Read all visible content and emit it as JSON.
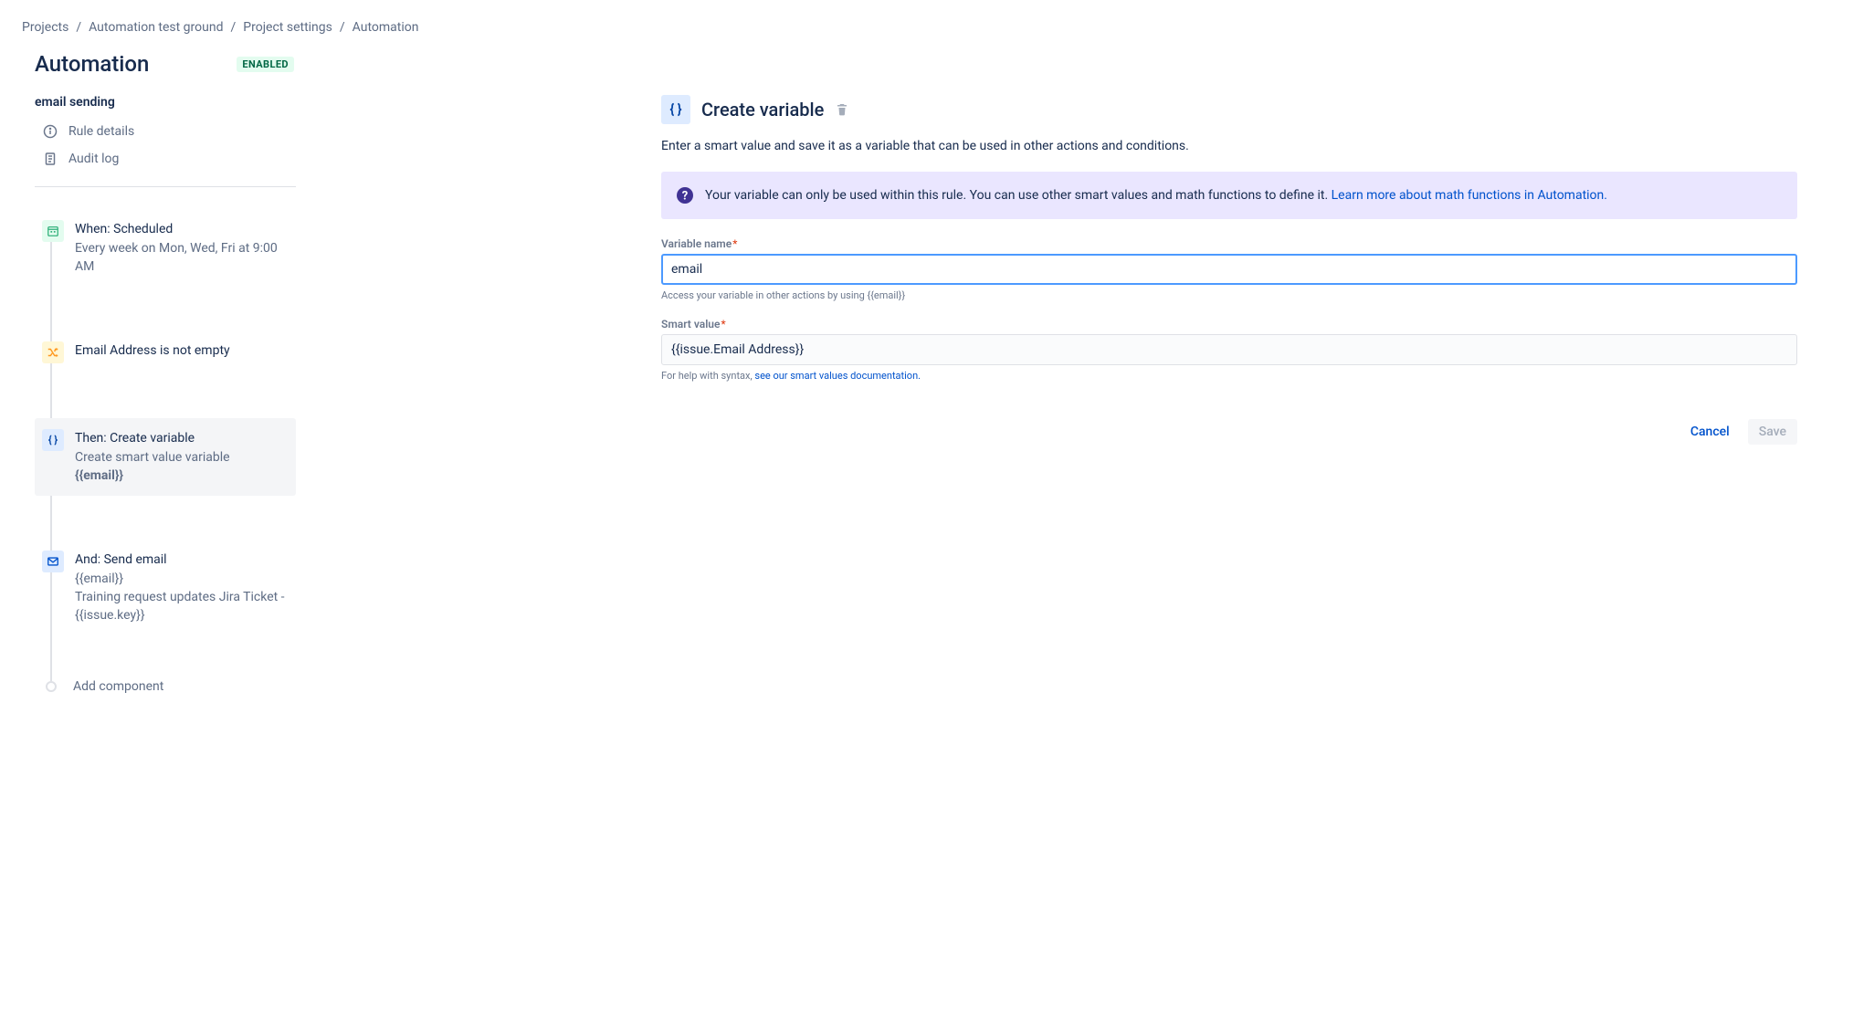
{
  "breadcrumb": {
    "projects": "Projects",
    "project": "Automation test ground",
    "settings": "Project settings",
    "current": "Automation"
  },
  "header": {
    "title": "Automation",
    "status": "ENABLED"
  },
  "rule": {
    "name": "email sending",
    "meta": {
      "details": "Rule details",
      "audit": "Audit log"
    },
    "flow": {
      "trigger": {
        "title": "When: Scheduled",
        "sub": "Every week on Mon, Wed, Fri at 9:00 AM"
      },
      "condition": {
        "title": "Email Address is not empty"
      },
      "action1": {
        "title": "Then: Create variable",
        "sub": "Create smart value variable",
        "var": "{{email}}"
      },
      "action2": {
        "title": "And: Send email",
        "line1": "{{email}}",
        "line2": "Training request updates Jira Ticket - {{issue.key}}"
      },
      "add": "Add component"
    }
  },
  "panel": {
    "title": "Create variable",
    "description": "Enter a smart value and save it as a variable that can be used in other actions and conditions.",
    "info": {
      "text": "Your variable can only be used within this rule. You can use other smart values and math functions to define it. ",
      "link": "Learn more about math functions in Automation."
    },
    "variable_name": {
      "label": "Variable name",
      "value": "email",
      "help": "Access your variable in other actions by using {{email}}"
    },
    "smart_value": {
      "label": "Smart value",
      "value": "{{issue.Email Address}}",
      "help_prefix": "For help with syntax, ",
      "help_link": "see our smart values documentation."
    },
    "buttons": {
      "cancel": "Cancel",
      "save": "Save"
    }
  }
}
